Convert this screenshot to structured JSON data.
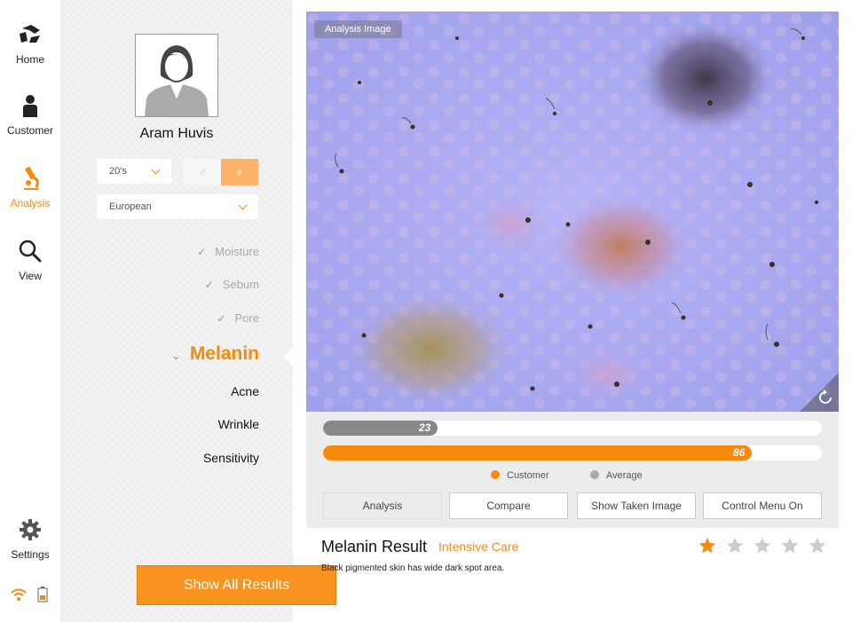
{
  "nav": {
    "items": [
      {
        "label": "Home",
        "icon": "home-logo-icon",
        "active": false
      },
      {
        "label": "Customer",
        "icon": "person-icon",
        "active": false
      },
      {
        "label": "Analysis",
        "icon": "microscope-icon",
        "active": true
      },
      {
        "label": "View",
        "icon": "search-icon",
        "active": false
      }
    ],
    "settings": {
      "label": "Settings",
      "icon": "gear-icon"
    },
    "status": {
      "wifi_icon": "wifi-icon",
      "battery_icon": "battery-icon"
    }
  },
  "profile": {
    "name": "Aram Huvis",
    "age_group": "20's",
    "ethnicity": "European",
    "gender_selected": "female"
  },
  "parameters": [
    {
      "label": "Moisture",
      "state": "done"
    },
    {
      "label": "Sebum",
      "state": "done"
    },
    {
      "label": "Pore",
      "state": "done"
    },
    {
      "label": "Melanin",
      "state": "active"
    },
    {
      "label": "Acne",
      "state": "todo"
    },
    {
      "label": "Wrinkle",
      "state": "todo"
    },
    {
      "label": "Sensitivity",
      "state": "todo"
    }
  ],
  "show_all_button": "Show All Results",
  "analysis": {
    "image_label": "Analysis Image",
    "average_value": 23,
    "customer_value": 86,
    "legend": {
      "customer": "Customer",
      "average": "Average"
    },
    "colors": {
      "customer": "#f7890f",
      "average": "#888888"
    }
  },
  "buttons": {
    "analysis": "Analysis",
    "compare": "Compare",
    "show_taken_image": "Show Taken Image",
    "control_menu": "Control Menu On"
  },
  "result": {
    "title": "Melanin Result",
    "level": "Intensive Care",
    "description": "Black pigmented skin has wide dark spot area.",
    "rating": 1,
    "rating_max": 5
  },
  "colors": {
    "accent": "#f7890f"
  }
}
